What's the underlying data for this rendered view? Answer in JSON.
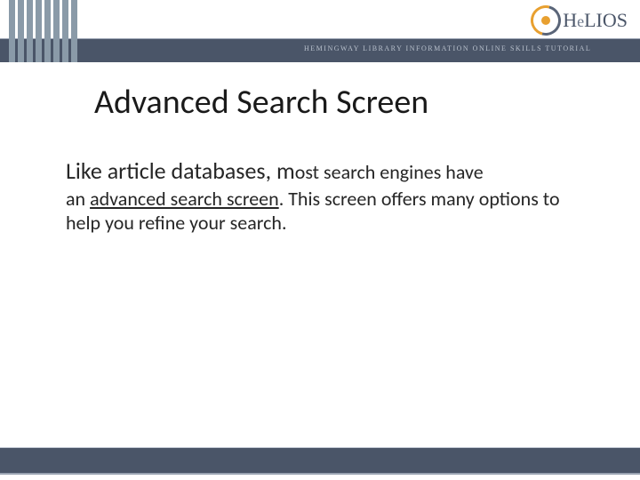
{
  "header": {
    "tagline": "HEMINGWAY LIBRARY INFORMATION ONLINE SKILLS TUTORIAL",
    "logo_text_1": "H",
    "logo_text_2": "e",
    "logo_text_3": "LIOS"
  },
  "slide": {
    "title": "Advanced Search Screen",
    "body_lead": "Like article databases, m",
    "body_rest": "ost search engines have",
    "body_line2_pre": "an ",
    "body_line2_underlined": "advanced search screen",
    "body_line2_post": ".  This screen offers many options to help you refine your search."
  }
}
